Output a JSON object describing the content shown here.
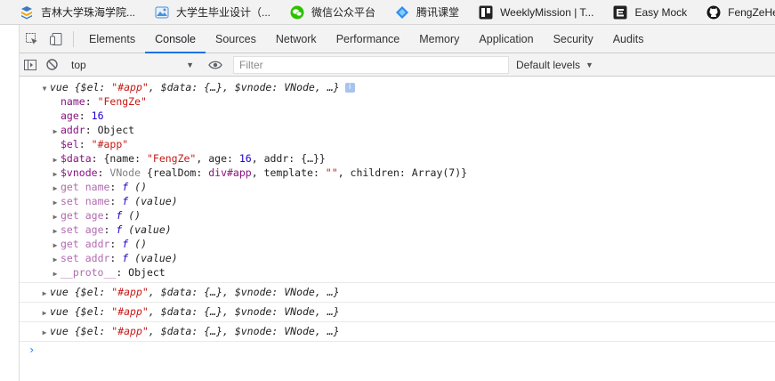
{
  "bookmarks": [
    {
      "label": "吉林大学珠海学院...",
      "icon": "jlu-logo-icon",
      "color": "#3b7ac4"
    },
    {
      "label": "大学生毕业设计（...",
      "icon": "landscape-icon",
      "color": "#4a90d9"
    },
    {
      "label": "微信公众平台",
      "icon": "wechat-icon",
      "color": "#2dc100"
    },
    {
      "label": "腾讯课堂",
      "icon": "tencent-class-icon",
      "color": "#2d8cf0"
    },
    {
      "label": "WeeklyMission | T...",
      "icon": "trello-icon",
      "color": "#222222"
    },
    {
      "label": "Easy Mock",
      "icon": "easy-mock-icon",
      "color": "#222222"
    },
    {
      "label": "FengZeHe",
      "icon": "github-icon",
      "color": "#181717"
    }
  ],
  "devtools": {
    "tabs": [
      "Elements",
      "Console",
      "Sources",
      "Network",
      "Performance",
      "Memory",
      "Application",
      "Security",
      "Audits"
    ],
    "active_tab": "Console"
  },
  "console_toolbar": {
    "context": "top",
    "filter_placeholder": "Filter",
    "levels": "Default levels"
  },
  "console": {
    "entry": {
      "label": "vue",
      "preview": {
        "el_key": "$el",
        "el_val": "\"#app\"",
        "data_key": "$data",
        "data_val": "{…}",
        "vnode_key": "$vnode",
        "vnode_val": "VNode",
        "more": "…"
      },
      "info": "i",
      "props": {
        "name_key": "name",
        "name_val": "\"FengZe\"",
        "age_key": "age",
        "age_val": "16",
        "addr_key": "addr",
        "addr_val": "Object",
        "el_key": "$el",
        "el_val": "\"#app\"",
        "data_key": "$data",
        "data_name_key": "name",
        "data_name_val": "\"FengZe\"",
        "data_age_key": "age",
        "data_age_val": "16",
        "data_addr_key": "addr",
        "data_addr_val": "{…}",
        "vnode_key": "$vnode",
        "vnode_class": "VNode",
        "vnode_realdom_key": "realDom",
        "vnode_realdom_val": "div#app",
        "vnode_template_key": "template",
        "vnode_template_val": "\"\"",
        "vnode_children_key": "children",
        "vnode_children_val": "Array(7)",
        "getters": [
          {
            "kind": "get",
            "name": "name",
            "sig": "()"
          },
          {
            "kind": "set",
            "name": "name",
            "sig": "(value)"
          },
          {
            "kind": "get",
            "name": "age",
            "sig": "()"
          },
          {
            "kind": "set",
            "name": "age",
            "sig": "(value)"
          },
          {
            "kind": "get",
            "name": "addr",
            "sig": "()"
          },
          {
            "kind": "set",
            "name": "addr",
            "sig": "(value)"
          }
        ],
        "fn_symbol": "f",
        "proto_key": "__proto__",
        "proto_val": "Object"
      }
    },
    "collapsed_count": 3,
    "prompt": "›"
  }
}
